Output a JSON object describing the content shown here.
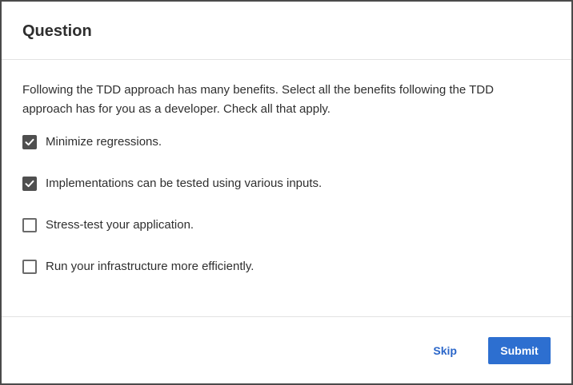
{
  "dialog": {
    "title": "Question",
    "prompt": "Following the TDD approach has many benefits. Select all the benefits following the TDD approach has for you as a developer. Check all that apply.",
    "options": [
      {
        "label": "Minimize regressions.",
        "checked": true
      },
      {
        "label": "Implementations can be tested using various inputs.",
        "checked": true
      },
      {
        "label": "Stress-test your application.",
        "checked": false
      },
      {
        "label": "Run your infrastructure more efficiently.",
        "checked": false
      }
    ],
    "skip_label": "Skip",
    "submit_label": "Submit"
  },
  "colors": {
    "accent": "#2d6fd0",
    "link": "#2a66c9",
    "checkbox_checked": "#4f4f4f"
  },
  "icons": {
    "check": "checkmark-icon"
  }
}
